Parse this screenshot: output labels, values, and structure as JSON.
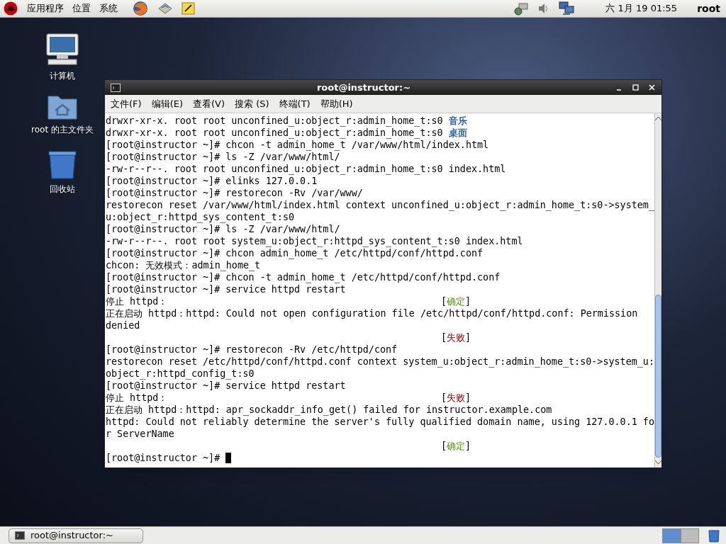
{
  "top_panel": {
    "menus": [
      "应用程序",
      "位置",
      "系统"
    ],
    "clock": "六 1月 19 01:55",
    "user": "root"
  },
  "desktop_icons": [
    {
      "kind": "computer",
      "label": "计算机"
    },
    {
      "kind": "home",
      "label": "root 的主文件夹"
    },
    {
      "kind": "trash",
      "label": "回收站"
    }
  ],
  "window": {
    "title": "root@instructor:~",
    "menu": [
      "文件(F)",
      "编辑(E)",
      "查看(V)",
      "搜索 (S)",
      "终端(T)",
      "帮助(H)"
    ],
    "lines": [
      {
        "segments": [
          {
            "text": "drwxr-xr-x. root root unconfined_u:object_r:admin_home_t:s0 ",
            "kind": "plain"
          },
          {
            "text": "音乐",
            "kind": "dir"
          }
        ]
      },
      {
        "segments": [
          {
            "text": "drwxr-xr-x. root root unconfined_u:object_r:admin_home_t:s0 ",
            "kind": "plain"
          },
          {
            "text": "桌面",
            "kind": "dir"
          }
        ]
      },
      {
        "segments": [
          {
            "text": "[root@instructor ~]# chcon -t admin_home_t /var/www/html/index.html",
            "kind": "plain"
          }
        ]
      },
      {
        "segments": [
          {
            "text": "[root@instructor ~]# ls -Z /var/www/html/",
            "kind": "plain"
          }
        ]
      },
      {
        "segments": [
          {
            "text": "-rw-r--r--. root root unconfined_u:object_r:admin_home_t:s0 index.html",
            "kind": "plain"
          }
        ]
      },
      {
        "segments": [
          {
            "text": "[root@instructor ~]# elinks 127.0.0.1",
            "kind": "plain"
          }
        ]
      },
      {
        "segments": [
          {
            "text": "[root@instructor ~]# restorecon -Rv /var/www/",
            "kind": "plain"
          }
        ]
      },
      {
        "segments": [
          {
            "text": "restorecon reset /var/www/html/index.html context unconfined_u:object_r:admin_home_t:s0->system_",
            "kind": "plain"
          }
        ]
      },
      {
        "segments": [
          {
            "text": "u:object_r:httpd_sys_content_t:s0",
            "kind": "plain"
          }
        ]
      },
      {
        "segments": [
          {
            "text": "[root@instructor ~]# ls -Z /var/www/html/",
            "kind": "plain"
          }
        ]
      },
      {
        "segments": [
          {
            "text": "-rw-r--r--. root root system_u:object_r:httpd_sys_content_t:s0 index.html",
            "kind": "plain"
          }
        ]
      },
      {
        "segments": [
          {
            "text": "[root@instructor ~]# chcon admin_home_t /etc/httpd/conf/httpd.conf",
            "kind": "plain"
          }
        ]
      },
      {
        "segments": [
          {
            "text": "chcon: 无效模式：admin_home_t",
            "kind": "plain"
          }
        ]
      },
      {
        "segments": [
          {
            "text": "[root@instructor ~]# chcon -t admin_home_t /etc/httpd/conf/httpd.conf",
            "kind": "plain"
          }
        ]
      },
      {
        "segments": [
          {
            "text": "[root@instructor ~]# service httpd restart",
            "kind": "plain"
          }
        ]
      },
      {
        "segments": [
          {
            "text": "停止 httpd：",
            "kind": "plain"
          }
        ],
        "status": {
          "open": "[",
          "label": "确定",
          "close": "]",
          "kind": "ok"
        }
      },
      {
        "segments": [
          {
            "text": "正在启动 httpd：httpd: Could not open configuration file /etc/httpd/conf/httpd.conf: Permission",
            "kind": "plain"
          }
        ]
      },
      {
        "segments": [
          {
            "text": "denied",
            "kind": "plain"
          }
        ]
      },
      {
        "status": {
          "open": "[",
          "label": "失败",
          "close": "]",
          "kind": "fail"
        }
      },
      {
        "segments": [
          {
            "text": "[root@instructor ~]# restorecon -Rv /etc/httpd/conf",
            "kind": "plain"
          }
        ]
      },
      {
        "segments": [
          {
            "text": "restorecon reset /etc/httpd/conf/httpd.conf context system_u:object_r:admin_home_t:s0->system_u:",
            "kind": "plain"
          }
        ]
      },
      {
        "segments": [
          {
            "text": "object_r:httpd_config_t:s0",
            "kind": "plain"
          }
        ]
      },
      {
        "segments": [
          {
            "text": "[root@instructor ~]# service httpd restart",
            "kind": "plain"
          }
        ]
      },
      {
        "segments": [
          {
            "text": "停止 httpd：",
            "kind": "plain"
          }
        ],
        "status": {
          "open": "[",
          "label": "失败",
          "close": "]",
          "kind": "fail"
        }
      },
      {
        "segments": [
          {
            "text": "正在启动 httpd：httpd: apr_sockaddr_info_get() failed for instructor.example.com",
            "kind": "plain"
          }
        ]
      },
      {
        "segments": [
          {
            "text": "httpd: Could not reliably determine the server's fully qualified domain name, using 127.0.0.1 fo",
            "kind": "plain"
          }
        ]
      },
      {
        "segments": [
          {
            "text": "r ServerName",
            "kind": "plain"
          }
        ]
      },
      {
        "status": {
          "open": "[",
          "label": "确定",
          "close": "]",
          "kind": "ok"
        }
      },
      {
        "segments": [
          {
            "text": "[root@instructor ~]# ",
            "kind": "plain"
          }
        ],
        "cursor": true
      }
    ]
  },
  "taskbar": {
    "tasks": [
      {
        "label": "root@instructor:~",
        "selected": false
      }
    ],
    "workspaces": [
      {
        "selected": true
      },
      {
        "selected": false
      }
    ]
  }
}
